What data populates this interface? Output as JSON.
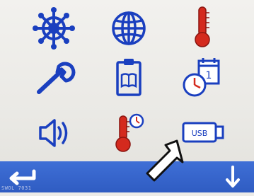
{
  "menu": {
    "usb_label": "USB",
    "calendar_day": "1"
  },
  "footer": {
    "caption": "SWOL 7031"
  },
  "colors": {
    "icon_blue": "#1a3fbf",
    "icon_red": "#d42a1e",
    "bar_blue": "#2f5cc2"
  }
}
